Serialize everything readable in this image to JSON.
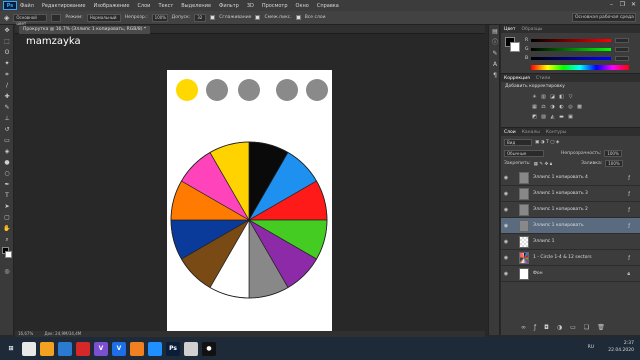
{
  "menu": [
    "Файл",
    "Редактирование",
    "Изображение",
    "Слои",
    "Текст",
    "Выделение",
    "Фильтр",
    "3D",
    "Просмотр",
    "Окно",
    "Справка"
  ],
  "app_badge": "Ps",
  "window_buttons": [
    "–",
    "❐",
    "✕"
  ],
  "options": {
    "style": "Основной цвет",
    "mode_label": "Режим:",
    "mode": "Нормальный",
    "opacity_label": "Непрозр.:",
    "opacity": "100%",
    "tolerance_label": "Допуск:",
    "tolerance": "32",
    "antialias": "Сглаживание",
    "contiguous": "Смеж.пикс.",
    "all_layers": "Все слои"
  },
  "workspace": "Основная рабочая среда",
  "document_tab": "Прокрутка @ 16,7% (Эллипс 1 копировать, RGB/8) *",
  "watermark": "mamzayka",
  "status": {
    "zoom": "16,67%",
    "doc": "Док: 24,9М/34,4М"
  },
  "colors_panel": {
    "tabs": [
      "Цвет",
      "Образцы"
    ],
    "labels": [
      "R",
      "G",
      "B"
    ]
  },
  "adjust_panel": {
    "tabs": [
      "Коррекция",
      "Стили"
    ],
    "title": "Добавить корректировку"
  },
  "layers_panel": {
    "tabs": [
      "Слои",
      "Каналы",
      "Контуры"
    ],
    "kind": "Вид",
    "blend": "Обычные",
    "opacity_label": "Непрозрачность:",
    "opacity": "100%",
    "lock_label": "Закрепить:",
    "fill_label": "Заливка:",
    "fill": "100%",
    "layers": [
      {
        "name": "Эллипс 1 копировать 4",
        "fx": true
      },
      {
        "name": "Эллипс 1 копировать 3",
        "fx": true
      },
      {
        "name": "Эллипс 1 копировать 2",
        "fx": true
      },
      {
        "name": "Эллипс 1 копировать",
        "fx": true,
        "selected": true
      },
      {
        "name": "Эллипс 1",
        "fx": false
      },
      {
        "name": "1 - Circle 1-4 & 12 sectors",
        "fx": true
      },
      {
        "name": "Фон",
        "fx": false,
        "locked": true
      }
    ]
  },
  "wheel": {
    "sectors": [
      "#0a0a0a",
      "#1e90f0",
      "#ff1a1a",
      "#44cc22",
      "#8c2aa8",
      "#888888",
      "#ffffff",
      "#7a4a14",
      "#0a3a9a",
      "#ff7a00",
      "#ff44bb",
      "#ffd300"
    ],
    "dots": [
      "#ffd800",
      "#8a8a8a",
      "#8a8a8a",
      "#8a8a8a",
      "#8a8a8a"
    ]
  },
  "tray": {
    "lang": "RU",
    "time": "2:37",
    "date": "22.04.2020"
  },
  "taskbar_apps": [
    {
      "label": "⊞",
      "color": "#1e2a38"
    },
    {
      "label": "",
      "color": "#e8e8e8"
    },
    {
      "label": "",
      "color": "#f4a020"
    },
    {
      "label": "",
      "color": "#2a7ad0"
    },
    {
      "label": "",
      "color": "#d62828"
    },
    {
      "label": "V",
      "color": "#7a4fd0"
    },
    {
      "label": "V",
      "color": "#1e6ee8"
    },
    {
      "label": "",
      "color": "#f08020"
    },
    {
      "label": "",
      "color": "#1e90ff"
    },
    {
      "label": "Ps",
      "color": "#0a1e3a"
    },
    {
      "label": "",
      "color": "#d0d0d0"
    },
    {
      "label": "●",
      "color": "#111111"
    }
  ]
}
